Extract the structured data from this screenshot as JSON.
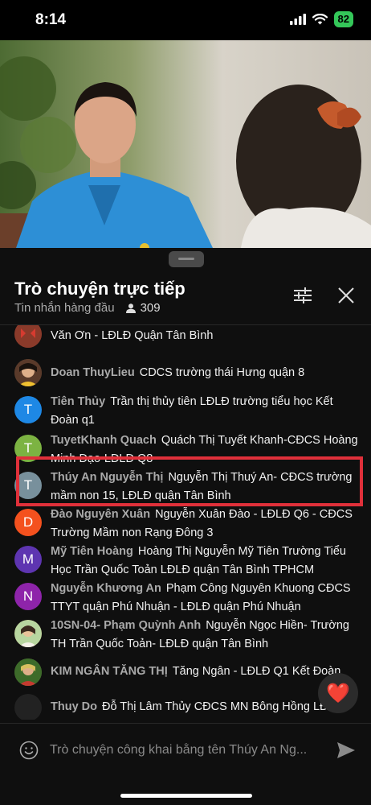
{
  "status": {
    "time": "8:14",
    "battery": "82"
  },
  "chat": {
    "title": "Trò chuyện trực tiếp",
    "subtitle": "Tin nhắn hàng đầu",
    "viewer_count": "309",
    "input_placeholder": "Trò chuyện công khai bằng tên Thúy An Ng...",
    "heart_emoji": "❤️"
  },
  "messages": [
    {
      "author": "",
      "text": "Văn Ơn - LĐLĐ Quận Tân Bình",
      "avatar_letter": "",
      "avatar_color": "#8a3a2a"
    },
    {
      "author": "Doan ThuyLieu",
      "text": "CDCS trường thái Hưng quận 8",
      "avatar_letter": "",
      "avatar_color": "#6b4e3a"
    },
    {
      "author": "Tiên Thủy",
      "text": "Trần thị thủy tiên LĐLĐ trường tiểu học Kết Đoàn q1",
      "avatar_letter": "T",
      "avatar_color": "#1e88e5"
    },
    {
      "author": "TuyetKhanh Quach",
      "text": "Quách Thị Tuyết Khanh-CĐCS Hoàng Minh Đạo-LĐLĐ Q8",
      "avatar_letter": "T",
      "avatar_color": "#7cb342"
    },
    {
      "author": "Thúy An Nguyễn Thị",
      "text": "Nguyễn Thị Thuý An- CĐCS trường mầm non 15, LĐLĐ quận Tân Bình",
      "avatar_letter": "T",
      "avatar_color": "#78909c"
    },
    {
      "author": "Đào Nguyên Xuân",
      "text": "Nguyễn Xuân Đào - LĐLĐ Q6 - CĐCS Trường Mầm non Rạng Đông 3",
      "avatar_letter": "D",
      "avatar_color": "#f4511e"
    },
    {
      "author": "Mỹ Tiên Hoàng",
      "text": "Hoàng Thị Nguyễn Mỹ Tiên Trường Tiểu Học Trần Quốc Toản LĐLĐ quận Tân Bình TPHCM",
      "avatar_letter": "M",
      "avatar_color": "#5e35b1"
    },
    {
      "author": "Nguyễn Khương An",
      "text": "Phạm Công Nguyên Khuong CĐCS TTYT quận Phú Nhuận - LĐLĐ quận Phú Nhuận",
      "avatar_letter": "N",
      "avatar_color": "#8e24aa"
    },
    {
      "author": "10SN-04- Phạm Quỳnh Anh",
      "text": "Nguyễn Ngọc Hiền- Trường TH Trần Quốc Toản- LĐLĐ quận Tân Bình",
      "avatar_letter": "",
      "avatar_color": "#c9a36b"
    },
    {
      "author": "KIM NGÂN TĂNG THỊ",
      "text": "Tăng Ngân - LĐLĐ Q1 Kết Đoàn",
      "avatar_letter": "",
      "avatar_color": "#5a7a3a"
    },
    {
      "author": "Thuy Do",
      "text": "Đỗ Thị Lâm Thủy CĐCS MN Bông Hồng LĐLĐ Q8",
      "avatar_letter": "",
      "avatar_color": "#222222"
    }
  ]
}
